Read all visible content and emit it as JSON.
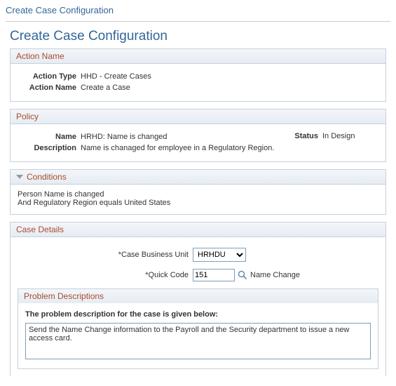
{
  "breadcrumb": "Create Case Configuration",
  "page_title": "Create Case Configuration",
  "action_name_section": {
    "title": "Action Name",
    "action_type_label": "Action Type",
    "action_type_value": "HHD - Create Cases",
    "action_name_label": "Action Name",
    "action_name_value": "Create a Case"
  },
  "policy_section": {
    "title": "Policy",
    "name_label": "Name",
    "name_value": "HRHD: Name is changed",
    "status_label": "Status",
    "status_value": "In Design",
    "description_label": "Description",
    "description_value": "Name is chanaged for employee in a Regulatory Region."
  },
  "conditions_section": {
    "title": "Conditions",
    "line1": "Person Name is changed",
    "line2": "And Regulatory Region equals United States"
  },
  "case_details_section": {
    "title": "Case Details",
    "cbu_label": "*Case Business Unit",
    "cbu_value": "HRHDU",
    "qc_label": "*Quick Code",
    "qc_value": "151",
    "qc_text": "Name Change",
    "problem_descriptions": {
      "title": "Problem Descriptions",
      "label": "The problem description for the case is given below:",
      "text": "Send the Name Change information to the Payroll and the Security department to issue a new access card."
    }
  }
}
